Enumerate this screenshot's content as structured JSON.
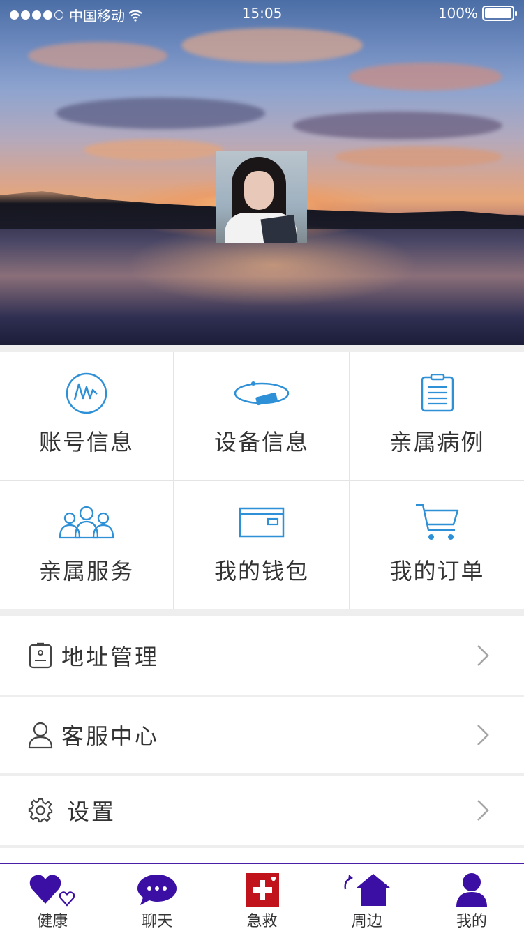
{
  "status_bar": {
    "carrier": "中国移动",
    "time": "15:05",
    "battery": "100%"
  },
  "grid": [
    {
      "label": "账号信息",
      "icon": "pulse-circle-icon"
    },
    {
      "label": "设备信息",
      "icon": "wristband-icon"
    },
    {
      "label": "亲属病例",
      "icon": "clipboard-icon"
    },
    {
      "label": "亲属服务",
      "icon": "people-group-icon"
    },
    {
      "label": "我的钱包",
      "icon": "wallet-icon"
    },
    {
      "label": "我的订单",
      "icon": "cart-icon"
    }
  ],
  "list": [
    {
      "label": "地址管理",
      "icon": "address-badge-icon"
    },
    {
      "label": "客服中心",
      "icon": "user-outline-icon"
    },
    {
      "label": "设置",
      "icon": "gear-icon"
    }
  ],
  "tabs": [
    {
      "label": "健康",
      "icon": "heart-icon"
    },
    {
      "label": "聊天",
      "icon": "chat-bubble-icon"
    },
    {
      "label": "急救",
      "icon": "first-aid-icon"
    },
    {
      "label": "周边",
      "icon": "home-refresh-icon"
    },
    {
      "label": "我的",
      "icon": "person-icon"
    }
  ],
  "colors": {
    "icon_blue": "#2e90d6",
    "tab_purple": "#3b0fa3",
    "first_aid_red": "#c0131b",
    "text": "#333333"
  }
}
